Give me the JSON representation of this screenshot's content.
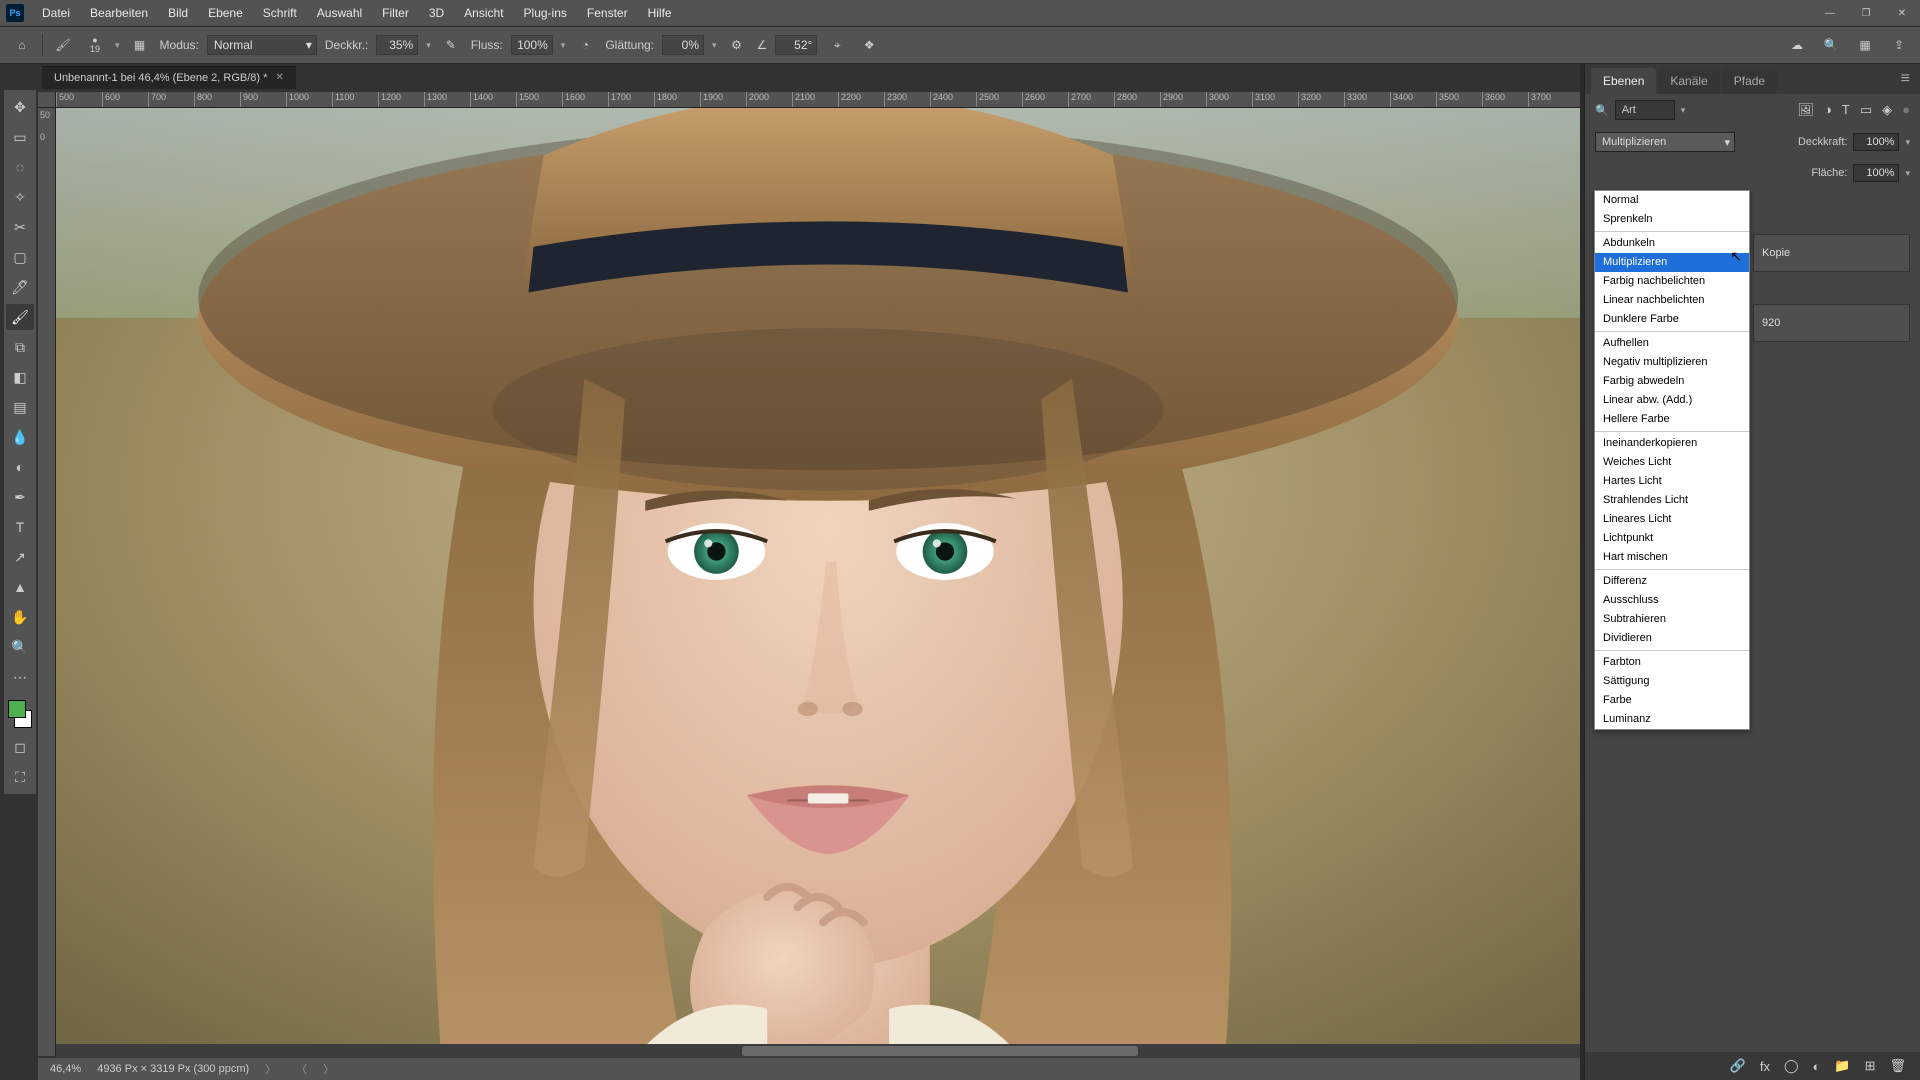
{
  "menubar": {
    "items": [
      "Datei",
      "Bearbeiten",
      "Bild",
      "Ebene",
      "Schrift",
      "Auswahl",
      "Filter",
      "3D",
      "Ansicht",
      "Plug-ins",
      "Fenster",
      "Hilfe"
    ]
  },
  "window_controls": {
    "min": "—",
    "max": "❐",
    "close": "✕"
  },
  "options": {
    "home": "⌂",
    "brush_size": "19",
    "mode_label": "Modus:",
    "mode_value": "Normal",
    "opacity_label": "Deckkr.:",
    "opacity_value": "35%",
    "flow_label": "Fluss:",
    "flow_value": "100%",
    "smoothing_label": "Glättung:",
    "smoothing_value": "0%",
    "angle_value": "52°"
  },
  "doc_tab": {
    "title": "Unbenannt-1 bei 46,4% (Ebene 2, RGB/8) *"
  },
  "ruler": {
    "ticks": [
      "500",
      "600",
      "700",
      "800",
      "900",
      "1000",
      "1100",
      "1200",
      "1300",
      "1400",
      "1500",
      "1600",
      "1700",
      "1800",
      "1900",
      "2000",
      "2100",
      "2200",
      "2300",
      "2400",
      "2500",
      "2600",
      "2700",
      "2800",
      "2900",
      "3000",
      "3100",
      "3200",
      "3300",
      "3400",
      "3500",
      "3600",
      "3700"
    ]
  },
  "ruler_v": {
    "ticks": [
      "50",
      "0"
    ]
  },
  "status": {
    "zoom": "46,4%",
    "dims": "4936 Px × 3319 Px (300 ppcm)"
  },
  "right_panel": {
    "tabs": [
      "Ebenen",
      "Kanäle",
      "Pfade"
    ],
    "search_prefix": "🔍",
    "search_value": "Art",
    "blend_value": "Multiplizieren",
    "opacity_label": "Deckkraft:",
    "opacity_value": "100%",
    "fill_label": "Fläche:",
    "fill_value": "100%",
    "layer_kopie": "Kopie",
    "layer_num": "920"
  },
  "blend_menu": {
    "groups": [
      [
        "Normal",
        "Sprenkeln"
      ],
      [
        "Abdunkeln",
        "Multiplizieren",
        "Farbig nachbelichten",
        "Linear nachbelichten",
        "Dunklere Farbe"
      ],
      [
        "Aufhellen",
        "Negativ multiplizieren",
        "Farbig abwedeln",
        "Linear abw. (Add.)",
        "Hellere Farbe"
      ],
      [
        "Ineinanderkopieren",
        "Weiches Licht",
        "Hartes Licht",
        "Strahlendes Licht",
        "Lineares Licht",
        "Lichtpunkt",
        "Hart mischen"
      ],
      [
        "Differenz",
        "Ausschluss",
        "Subtrahieren",
        "Dividieren"
      ],
      [
        "Farbton",
        "Sättigung",
        "Farbe",
        "Luminanz"
      ]
    ],
    "selected": "Multiplizieren"
  },
  "tools": {
    "items": [
      "move",
      "artboard",
      "lasso",
      "wand",
      "crop",
      "frame",
      "eyedrop",
      "brush",
      "stamp",
      "eraser",
      "gradient",
      "blur",
      "dodge",
      "pen",
      "text",
      "path",
      "shape",
      "hand",
      "zoom",
      "dots"
    ]
  },
  "icons": {
    "move": "✥",
    "artboard": "▭",
    "lasso": "◌",
    "wand": "✧",
    "crop": "✂",
    "frame": "▢",
    "eyedrop": "🖊",
    "brush": "🖌",
    "stamp": "⧉",
    "eraser": "◧",
    "gradient": "▤",
    "blur": "💧",
    "dodge": "◐",
    "pen": "✒",
    "text": "T",
    "path": "↗",
    "shape": "▲",
    "hand": "✋",
    "zoom": "🔍",
    "dots": "⋯",
    "picker": "◉",
    "pressure": "✎",
    "airbrush": "◔",
    "gear": "⚙",
    "angle": "∠",
    "tablet": "⌖",
    "sym": "❖",
    "cloud": "☁",
    "search": "🔍",
    "grid": "▦",
    "share": "⇪",
    "filter": "▾",
    "img": "🖼",
    "adj": "◑",
    "txt": "T",
    "shp": "▭",
    "so": "◈",
    "link": "🔗",
    "fx": "fx",
    "mask": "◯",
    "fill": "◐",
    "folder": "📁",
    "new": "⊞",
    "trash": "🗑"
  }
}
